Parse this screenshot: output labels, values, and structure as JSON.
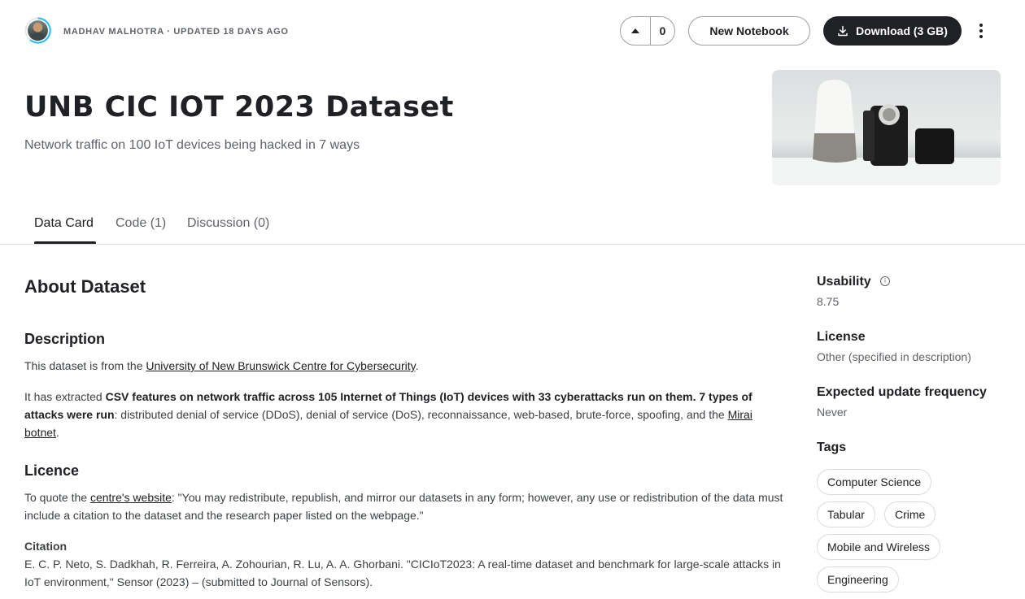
{
  "header": {
    "author_line": "MADHAV MALHOTRA · UPDATED 18 DAYS AGO",
    "vote_count": "0",
    "new_notebook_label": "New Notebook",
    "download_label": "Download (3 GB)",
    "title": "UNB CIC IOT 2023 Dataset",
    "subtitle": "Network traffic on 100 IoT devices being hacked in 7 ways"
  },
  "tabs": [
    {
      "label": "Data Card"
    },
    {
      "label": "Code (1)"
    },
    {
      "label": "Discussion (0)"
    }
  ],
  "about": {
    "heading": "About Dataset",
    "description_heading": "Description",
    "p1_prefix": "This dataset is from the ",
    "p1_link": "University of New Brunswick Centre for Cybersecurity",
    "p1_suffix": ".",
    "p2_prefix": "It has extracted ",
    "p2_bold": "CSV features on network traffic across 105 Internet of Things (IoT) devices with 33 cyberattacks run on them. 7 types of attacks were run",
    "p2_mid": ": distributed denial of service (DDoS), denial of service (DoS), reconnaissance, web-based, brute-force, spoofing, and the ",
    "p2_link": "Mirai botnet",
    "p2_suffix": ".",
    "licence_heading": "Licence",
    "p3_prefix": "To quote the ",
    "p3_link": "centre's website",
    "p3_suffix": ": \"You may redistribute, republish, and mirror our datasets in any form; however, any use or redistribution of the data must include a citation to the dataset and the research paper listed on the webpage.\"",
    "citation_heading": "Citation",
    "citation_text": "E. C. P. Neto, S. Dadkhah, R. Ferreira, A. Zohourian, R. Lu, A. A. Ghorbani. \"CICIoT2023: A real-time dataset and benchmark for large-scale attacks in IoT environment,\" Sensor (2023) – (submitted to Journal of Sensors)."
  },
  "sidebar": {
    "usability_label": "Usability",
    "usability_value": "8.75",
    "license_label": "License",
    "license_value": "Other (specified in description)",
    "frequency_label": "Expected update frequency",
    "frequency_value": "Never",
    "tags_label": "Tags",
    "tags": [
      "Computer Science",
      "Tabular",
      "Crime",
      "Mobile and Wireless",
      "Engineering"
    ]
  },
  "icons": {
    "upvote": "triangle-up-icon",
    "download": "download-icon",
    "more": "kebab-menu-icon",
    "info": "info-icon"
  },
  "colors": {
    "primary_text": "#202124",
    "secondary_text": "#5f6368",
    "ring_blue": "#20beff",
    "divider": "#dadce0"
  }
}
